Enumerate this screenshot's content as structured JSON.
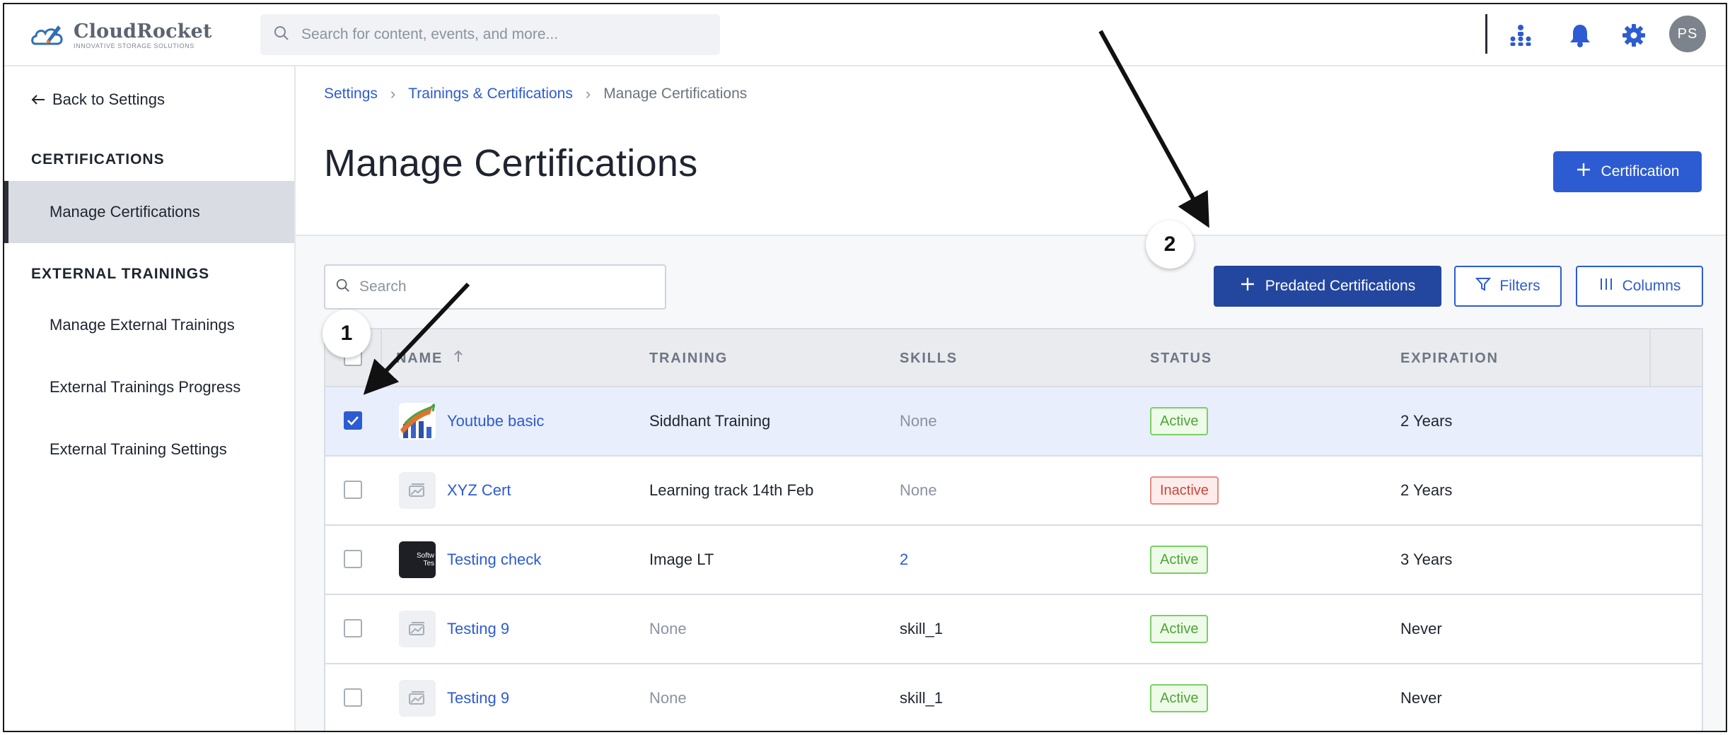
{
  "brand": {
    "name": "CloudRocket",
    "tagline": "INNOVATIVE STORAGE SOLUTIONS"
  },
  "topbar": {
    "search_placeholder": "Search for content, events, and more...",
    "icons": [
      "org-chart-icon",
      "bell-icon",
      "gear-icon"
    ],
    "avatar_initials": "PS",
    "accent": "#2d5bd1"
  },
  "sidebar": {
    "back_label": "Back to Settings",
    "sections": [
      {
        "title": "CERTIFICATIONS",
        "items": [
          {
            "label": "Manage Certifications",
            "active": true
          }
        ]
      },
      {
        "title": "EXTERNAL TRAININGS",
        "items": [
          {
            "label": "Manage External Trainings",
            "active": false
          },
          {
            "label": "External Trainings Progress",
            "active": false
          },
          {
            "label": "External Training Settings",
            "active": false
          }
        ]
      }
    ]
  },
  "breadcrumb": {
    "items": [
      "Settings",
      "Trainings & Certifications"
    ],
    "current": "Manage Certifications"
  },
  "page": {
    "title": "Manage Certifications",
    "add_button": "Certification"
  },
  "toolbar": {
    "search_placeholder": "Search",
    "predated_button": "Predated Certifications",
    "filters_button": "Filters",
    "columns_button": "Columns"
  },
  "callouts": {
    "one": "1",
    "two": "2"
  },
  "table": {
    "headers": [
      "NAME",
      "TRAINING",
      "SKILLS",
      "STATUS",
      "EXPIRATION"
    ],
    "rows": [
      {
        "name": "Youtube basic",
        "training": "Siddhant Training",
        "skills": "None",
        "status": "Active",
        "expiration": "2 Years",
        "checked": true,
        "thumb": "chart-thumbnail"
      },
      {
        "name": "XYZ Cert",
        "training": "Learning track 14th Feb",
        "skills": "None",
        "status": "Inactive",
        "expiration": "2 Years",
        "checked": false,
        "thumb": "placeholder-image-icon"
      },
      {
        "name": "Testing check",
        "training": "Image LT",
        "skills": "2",
        "status": "Active",
        "expiration": "3 Years",
        "checked": false,
        "thumb": "dark-thumbnail",
        "thumb_text": "Softw Tes"
      },
      {
        "name": "Testing 9",
        "training": "None",
        "skills": "skill_1",
        "status": "Active",
        "expiration": "Never",
        "checked": false,
        "thumb": "placeholder-image-icon"
      },
      {
        "name": "Testing 9",
        "training": "None",
        "skills": "skill_1",
        "status": "Active",
        "expiration": "Never",
        "checked": false,
        "thumb": "placeholder-image-icon"
      }
    ]
  },
  "colors": {
    "primary": "#2d5bd1",
    "primary_dark": "#23469f",
    "active_green": "#4ea43b",
    "inactive_red": "#c9473a"
  }
}
